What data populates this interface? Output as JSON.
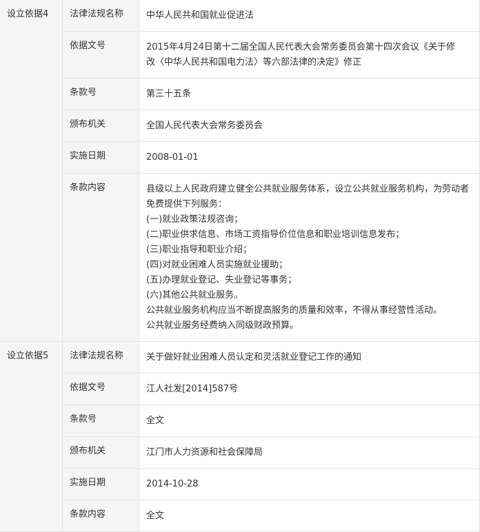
{
  "sections": [
    {
      "title": "设立依据4",
      "rows": [
        {
          "label": "法律法规名称",
          "lines": [
            "中华人民共和国就业促进法"
          ]
        },
        {
          "label": "依据文号",
          "lines": [
            "2015年4月24日第十二届全国人民代表大会常务委员会第十四次会议《关于修",
            "改〈中华人民共和国电力法〉等六部法律的决定》修正"
          ]
        },
        {
          "label": "条款号",
          "lines": [
            "第三十五条"
          ]
        },
        {
          "label": "颁布机关",
          "lines": [
            "全国人民代表大会常务委员会"
          ]
        },
        {
          "label": "实施日期",
          "lines": [
            "2008-01-01"
          ]
        },
        {
          "label": "条款内容",
          "lines": [
            "县级以上人民政府建立健全公共就业服务体系，设立公共就业服务机构，为劳动者",
            "免费提供下列服务：",
            "(一)就业政策法规咨询；",
            "(二)职业供求信息、市场工资指导价位信息和职业培训信息发布；",
            "(三)职业指导和职业介绍；",
            "(四)对就业困难人员实施就业援助；",
            "(五)办理就业登记、失业登记等事务；",
            "(六)其他公共就业服务。",
            "公共就业服务机构应当不断提高服务的质量和效率，不得从事经营性活动。",
            "公共就业服务经费纳入同级财政预算。"
          ]
        }
      ]
    },
    {
      "title": "设立依据5",
      "rows": [
        {
          "label": "法律法规名称",
          "lines": [
            "关于做好就业困难人员认定和灵活就业登记工作的通知"
          ]
        },
        {
          "label": "依据文号",
          "lines": [
            "江人社发[2014]587号"
          ]
        },
        {
          "label": "条款号",
          "lines": [
            "全文"
          ]
        },
        {
          "label": "颁布机关",
          "lines": [
            "江门市人力资源和社会保障局"
          ]
        },
        {
          "label": "实施日期",
          "lines": [
            "2014-10-28"
          ]
        },
        {
          "label": "条款内容",
          "lines": [
            "全文"
          ]
        }
      ]
    }
  ]
}
